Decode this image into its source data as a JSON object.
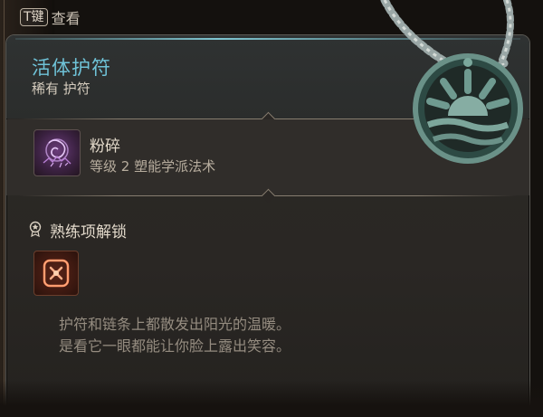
{
  "hint": {
    "key": "T键",
    "action": "查看"
  },
  "item": {
    "name": "活体护符",
    "subtitle": "稀有 护符"
  },
  "spell": {
    "name": "粉碎",
    "description": "等级 2 塑能学派法术",
    "icon": "shatter-spell-icon"
  },
  "proficiency": {
    "title": "熟练项解锁",
    "icon": "weapon-proficiency-icon"
  },
  "flavor_text": [
    "护符和链条上都散发出阳光的温暖。",
    "是看它一眼都能让你脸上露出笑容。"
  ],
  "colors": {
    "title": "#6fc3d8",
    "accent_line": "#7fc6d1",
    "body_text": "#e3dacb",
    "flavor_text": "#958c80"
  }
}
